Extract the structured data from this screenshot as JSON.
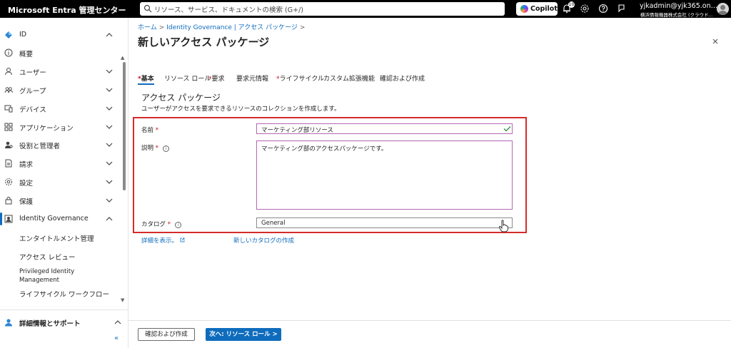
{
  "topbar": {
    "brand": "Microsoft Entra 管理センター",
    "search_placeholder": "リソース、サービス、ドキュメントの検索 (G+/)",
    "copilot_label": "Copilot",
    "notification_count": "10",
    "account_user": "yjkadmin@yjk365.on…",
    "account_tenant": "横浜情報機器株式会社 (クラウド…"
  },
  "sidebar": {
    "items": [
      {
        "label": "ID",
        "icon": "diamond-icon",
        "chevron": "up"
      },
      {
        "label": "概要",
        "icon": "info-icon"
      },
      {
        "label": "ユーザー",
        "icon": "person-icon",
        "chevron": "down"
      },
      {
        "label": "グループ",
        "icon": "group-icon",
        "chevron": "down"
      },
      {
        "label": "デバイス",
        "icon": "devices-icon",
        "chevron": "down"
      },
      {
        "label": "アプリケーション",
        "icon": "apps-icon",
        "chevron": "down"
      },
      {
        "label": "役割と管理者",
        "icon": "roles-icon",
        "chevron": "down"
      },
      {
        "label": "請求",
        "icon": "billing-icon",
        "chevron": "down"
      },
      {
        "label": "設定",
        "icon": "gear-icon",
        "chevron": "down"
      },
      {
        "label": "保護",
        "icon": "lock-icon",
        "chevron": "down"
      },
      {
        "label": "Identity Governance",
        "icon": "governance-icon",
        "chevron": "up"
      }
    ],
    "subitems": [
      "エンタイトルメント管理",
      "アクセス レビュー",
      "Privileged Identity Management",
      "ライフサイクル ワークフロー"
    ],
    "help_label": "詳細情報とサポート"
  },
  "main": {
    "breadcrumb": [
      "ホーム",
      "Identity Governance | アクセス パッケージ"
    ],
    "title": "新しいアクセス パッケージ",
    "tabs": [
      {
        "label": "基本",
        "required": true
      },
      {
        "label": "リソース ロール",
        "required": false
      },
      {
        "label": "要求",
        "required": true
      },
      {
        "label": "要求元情報",
        "required": false
      },
      {
        "label": "ライフサイクル",
        "required": true
      },
      {
        "label": "カスタム拡張機能",
        "required": false
      },
      {
        "label": "確認および作成",
        "required": false
      }
    ],
    "section_title": "アクセス パッケージ",
    "section_desc": "ユーザーがアクセスを要求できるリソースのコレクションを作成します。",
    "fields": {
      "name_label": "名前",
      "name_value": "マーケティング部リソース",
      "desc_label": "説明",
      "desc_value": "マーケティング部のアクセスパッケージです。",
      "catalog_label": "カタログ",
      "catalog_value": "General"
    },
    "links": {
      "details": "詳細を表示。",
      "new_catalog": "新しいカタログの作成"
    }
  },
  "footer": {
    "review_button": "確認および作成",
    "next_button": "次へ: リソース ロール >"
  },
  "colors": {
    "accent": "#0f6cbd",
    "highlight": "#d62b2b",
    "required": "#c50f1f"
  }
}
